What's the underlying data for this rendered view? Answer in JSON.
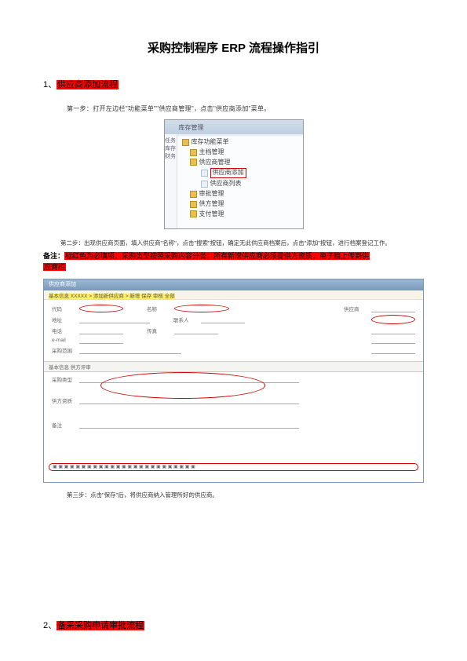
{
  "title": "采购控制程序 ERP 流程操作指引",
  "section1": {
    "num": "1、",
    "label": "供应商添加流程"
  },
  "step1": "第一步：打开左边栏\"功能菜单\"\"供应商管理\"，点击\"供应商添加\"菜单。",
  "tree": {
    "title": "库存管理",
    "sidebar": "任务 库存 财务",
    "root": "库存功能菜单",
    "items": [
      {
        "label": "主档管理",
        "lvl": 1
      },
      {
        "label": "供应商管理",
        "lvl": 1
      },
      {
        "label": "供应商添加",
        "lvl": 2,
        "red": true
      },
      {
        "label": "供应商列表",
        "lvl": 2
      },
      {
        "label": "审批管理",
        "lvl": 1
      },
      {
        "label": "供方管理",
        "lvl": 1
      },
      {
        "label": "支付管理",
        "lvl": 1
      }
    ]
  },
  "step2": "第二步：出现供应商页面，填入供应商\"名称\"，点击\"搜索\"按钮，确定无此供应商档案后，点击\"添加\"按钮，进行档案登记工作。",
  "note_label": "备注：",
  "note_text1": "标红色为必填项，采购类型按照采购内容分类；所有新增供应商必须提供方资质，电子档上传到供",
  "note_text2": "应商栏",
  "form": {
    "window_title": "供应商添加",
    "toolbar": "基本信息 XXXXX > 添加新供应商 > 新增 保存 审核 全部",
    "rows": [
      [
        {
          "l": "代码",
          "v": ""
        },
        {
          "l": "名称",
          "v": ""
        },
        {
          "l": "供应商",
          "v": ""
        }
      ],
      [
        {
          "l": "地址",
          "v": ""
        },
        {
          "l": "联系人",
          "v": ""
        },
        {
          "l": "",
          "v": ""
        }
      ],
      [
        {
          "l": "电话",
          "v": ""
        },
        {
          "l": "传真",
          "v": ""
        },
        {
          "l": "",
          "v": ""
        }
      ],
      [
        {
          "l": "e-mail",
          "v": ""
        },
        {
          "l": "",
          "v": ""
        },
        {
          "l": "",
          "v": ""
        }
      ]
    ],
    "lower_rows": [
      {
        "l": "采购范围",
        "v": ""
      },
      {
        "l": "采购类型",
        "v": ""
      },
      {
        "l": "供方资质",
        "v": ""
      },
      {
        "l": "备注",
        "v": ""
      }
    ],
    "tabs": "基本信息  供方评审",
    "bottom": "▣ ▣ ▣ ▣ ▣ ▣ ▣ ▣ ▣ ▣ ▣ ▣ ▣ ▣ ▣ ▣ ▣ ▣ ▣ ▣ ▣ ▣ ▣ ▣ ▣"
  },
  "step3": "第三步：点击\"保存\"后，将供应商纳入管理所好的供应商。",
  "section2": {
    "num": "2、",
    "label": "备采采购申请审批流程"
  }
}
